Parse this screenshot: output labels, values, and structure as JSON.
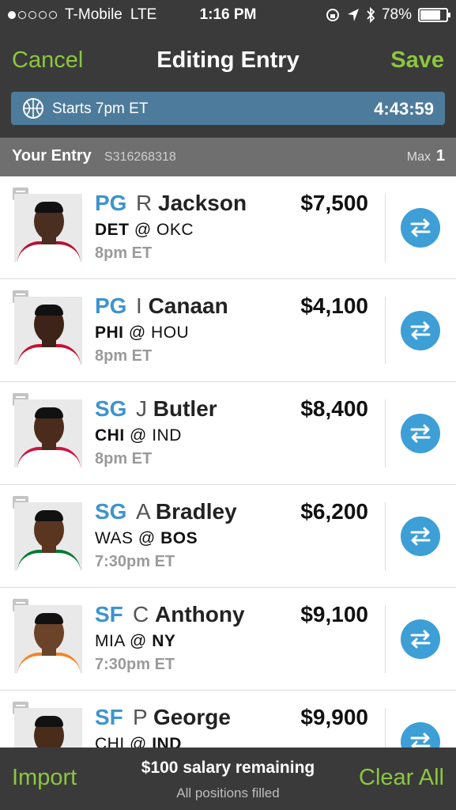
{
  "status_bar": {
    "carrier": "T-Mobile",
    "network": "LTE",
    "time": "1:16 PM",
    "battery": "78%",
    "battery_level": 0.78
  },
  "nav": {
    "cancel": "Cancel",
    "title": "Editing Entry",
    "save": "Save"
  },
  "timer": {
    "label": "Starts 7pm ET",
    "countdown": "4:43:59"
  },
  "entry_header": {
    "label": "Your Entry",
    "entry_id": "S316268318",
    "max_label": "Max",
    "max_value": "1"
  },
  "players": [
    {
      "pos": "PG",
      "initial": "R",
      "last": "Jackson",
      "salary": "$7,500",
      "away": "DET",
      "at": "@",
      "home": "OKC",
      "bold": "away",
      "time": "8pm ET",
      "skin": "#4a2e1f",
      "jersey": "#ffffff",
      "trim": "#b8102f"
    },
    {
      "pos": "PG",
      "initial": "I",
      "last": "Canaan",
      "salary": "$4,100",
      "away": "PHI",
      "at": "@",
      "home": "HOU",
      "bold": "away",
      "time": "8pm ET",
      "skin": "#3e2418",
      "jersey": "#ffffff",
      "trim": "#c8102e"
    },
    {
      "pos": "SG",
      "initial": "J",
      "last": "Butler",
      "salary": "$8,400",
      "away": "CHI",
      "at": "@",
      "home": "IND",
      "bold": "away",
      "time": "8pm ET",
      "skin": "#4b2c1c",
      "jersey": "#ffffff",
      "trim": "#ce1141"
    },
    {
      "pos": "SG",
      "initial": "A",
      "last": "Bradley",
      "salary": "$6,200",
      "away": "WAS",
      "at": "@",
      "home": "BOS",
      "bold": "home",
      "time": "7:30pm ET",
      "skin": "#5a3520",
      "jersey": "#ffffff",
      "trim": "#007a33"
    },
    {
      "pos": "SF",
      "initial": "C",
      "last": "Anthony",
      "salary": "$9,100",
      "away": "MIA",
      "at": "@",
      "home": "NY",
      "bold": "home",
      "time": "7:30pm ET",
      "skin": "#6b4329",
      "jersey": "#ffffff",
      "trim": "#f58426"
    },
    {
      "pos": "SF",
      "initial": "P",
      "last": "George",
      "salary": "$9,900",
      "away": "CHI",
      "at": "@",
      "home": "IND",
      "bold": "home",
      "time": "",
      "skin": "#4a2c1b",
      "jersey": "#002d62",
      "trim": "#fdbb30"
    }
  ],
  "footer": {
    "import": "Import",
    "salary_remaining": "$100 salary remaining",
    "positions": "All positions filled",
    "clear_all": "Clear All"
  },
  "icons": {
    "note": "note-icon",
    "swap": "swap-icon",
    "ball": "basketball-icon"
  },
  "colors": {
    "accent_green": "#8cc63f",
    "position_blue": "#3d94cd",
    "swap_blue": "#3d9fd6",
    "timer_bg": "#4d7b9b"
  }
}
